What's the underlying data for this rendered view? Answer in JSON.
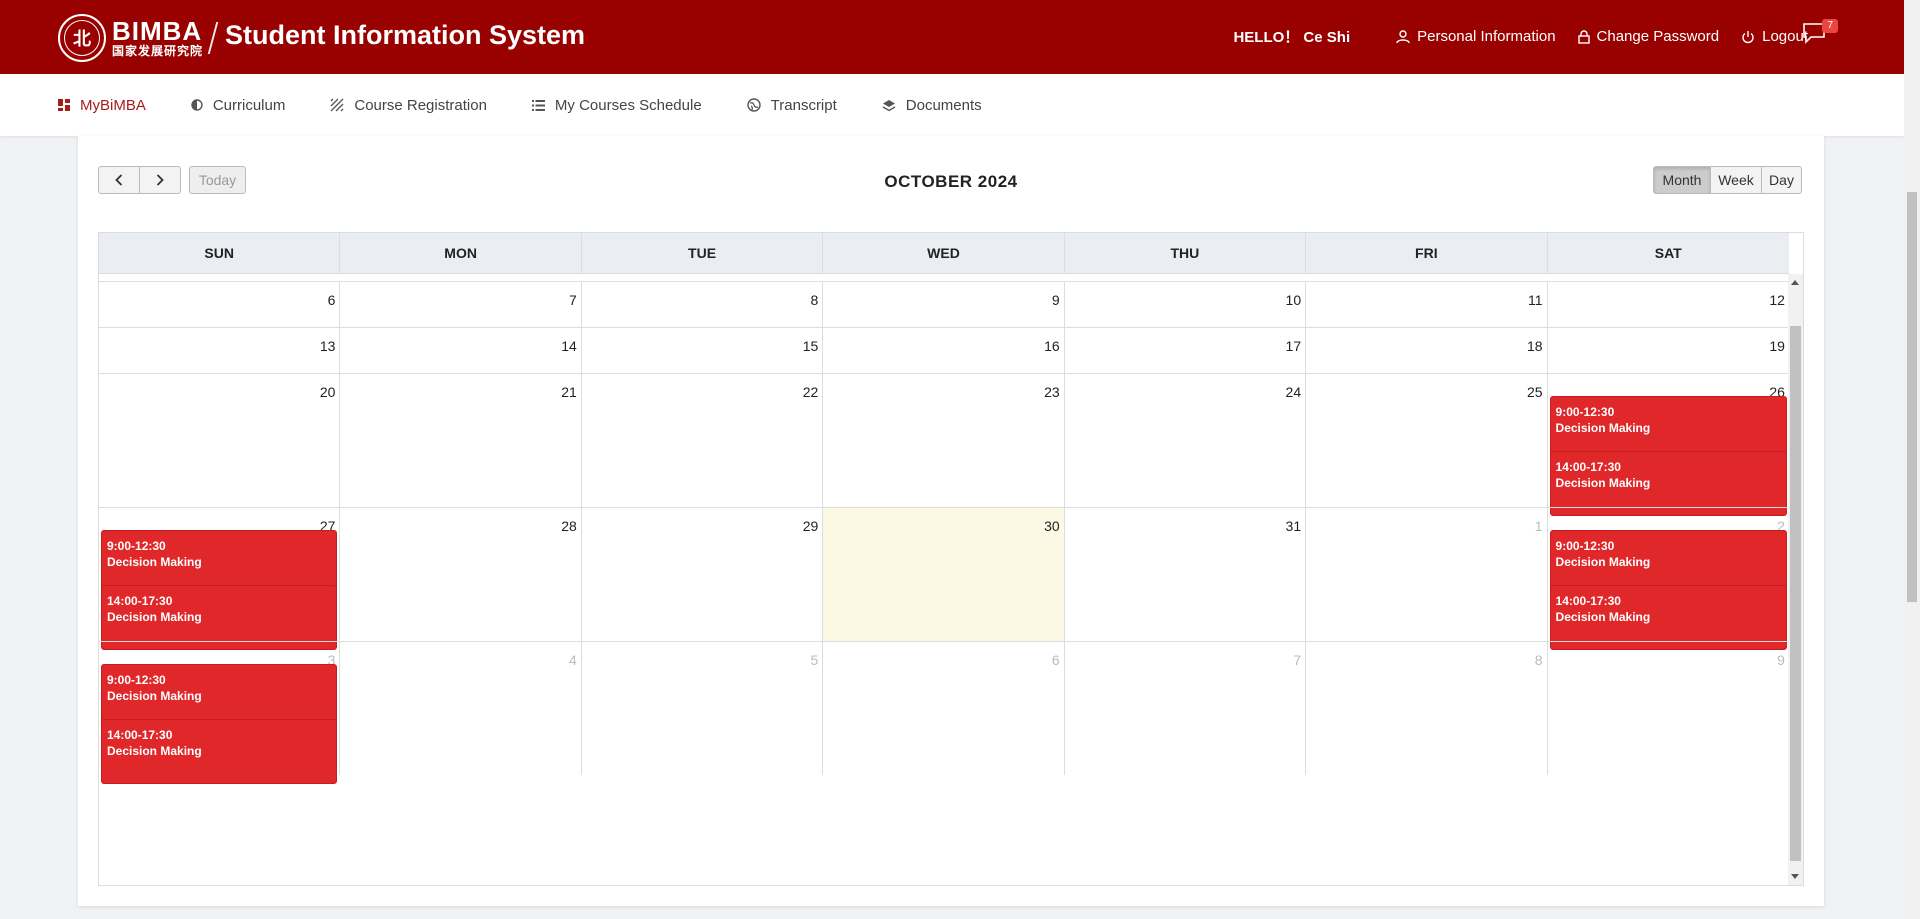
{
  "header": {
    "logo_letter": "北",
    "brand_en": "BIMBA",
    "brand_cn": "国家发展研究院",
    "system_title": "Student Information System",
    "hello": "HELLO！ Ce Shi",
    "personal_info": "Personal Information",
    "change_password": "Change Password",
    "logout": "Logout",
    "notification_count": "7"
  },
  "nav": [
    {
      "label": "MyBiMBA",
      "icon": "dashboard-icon",
      "active": true
    },
    {
      "label": "Curriculum",
      "icon": "half-circle-icon"
    },
    {
      "label": "Course Registration",
      "icon": "hatch-icon"
    },
    {
      "label": "My Courses Schedule",
      "icon": "list-icon"
    },
    {
      "label": "Transcript",
      "icon": "globe-icon"
    },
    {
      "label": "Documents",
      "icon": "layers-icon"
    }
  ],
  "calendar": {
    "title": "OCTOBER 2024",
    "today_label": "Today",
    "views": {
      "month": "Month",
      "week": "Week",
      "day": "Day"
    },
    "active_view": "Month",
    "days_of_week": [
      "SUN",
      "MON",
      "TUE",
      "WED",
      "THU",
      "FRI",
      "SAT"
    ],
    "weeks": [
      [
        "6",
        "7",
        "8",
        "9",
        "10",
        "11",
        "12"
      ],
      [
        "13",
        "14",
        "15",
        "16",
        "17",
        "18",
        "19"
      ],
      [
        "20",
        "21",
        "22",
        "23",
        "24",
        "25",
        "26"
      ],
      [
        "27",
        "28",
        "29",
        "30",
        "31",
        "1",
        "2"
      ],
      [
        "3",
        "4",
        "5",
        "6",
        "7",
        "8",
        "9"
      ]
    ],
    "today_date": "30",
    "events": [
      {
        "week": 2,
        "day": 6,
        "time": "9:00-12:30",
        "title": "Decision Making"
      },
      {
        "week": 2,
        "day": 6,
        "time": "14:00-17:30",
        "title": "Decision Making"
      },
      {
        "week": 3,
        "day": 0,
        "time": "9:00-12:30",
        "title": "Decision Making"
      },
      {
        "week": 3,
        "day": 0,
        "time": "14:00-17:30",
        "title": "Decision Making"
      },
      {
        "week": 3,
        "day": 6,
        "time": "9:00-12:30",
        "title": "Decision Making"
      },
      {
        "week": 3,
        "day": 6,
        "time": "14:00-17:30",
        "title": "Decision Making"
      },
      {
        "week": 4,
        "day": 0,
        "time": "9:00-12:30",
        "title": "Decision Making"
      },
      {
        "week": 4,
        "day": 0,
        "time": "14:00-17:30",
        "title": "Decision Making"
      }
    ]
  },
  "colors": {
    "header_bg": "#990000",
    "active_nav": "#a81c1c",
    "event_bg": "#e0282b",
    "today_bg": "#fcf8e3"
  }
}
